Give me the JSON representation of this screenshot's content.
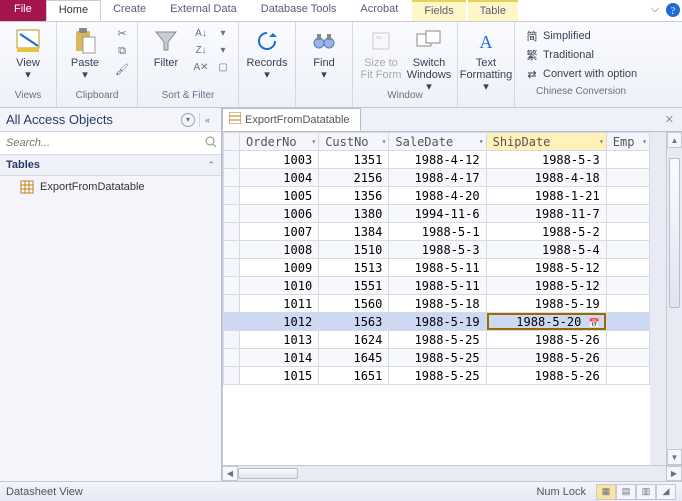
{
  "menubar": {
    "file": "File",
    "tabs": [
      "Home",
      "Create",
      "External Data",
      "Database Tools",
      "Acrobat"
    ],
    "context_tabs": [
      "Fields",
      "Table"
    ],
    "active": "Home"
  },
  "ribbon": {
    "views": {
      "view_label": "View",
      "group": "Views"
    },
    "clipboard": {
      "paste": "Paste",
      "group": "Clipboard"
    },
    "sortfilter": {
      "filter": "Filter",
      "group": "Sort & Filter"
    },
    "records": {
      "records": "Records",
      "group": ""
    },
    "find": {
      "find": "Find",
      "group": ""
    },
    "window": {
      "size": "Size to\nFit Form",
      "switch": "Switch\nWindows",
      "group": "Window"
    },
    "textfmt": {
      "text": "Text\nFormatting",
      "group": ""
    },
    "chinese": {
      "simplified": "Simplified",
      "traditional": "Traditional",
      "convert": "Convert with option",
      "group": "Chinese Conversion"
    }
  },
  "nav": {
    "title": "All Access Objects",
    "search_placeholder": "Search...",
    "group_tables": "Tables",
    "items": [
      "ExportFromDatatable"
    ]
  },
  "doc": {
    "tabname": "ExportFromDatatable",
    "columns": [
      "OrderNo",
      "CustNo",
      "SaleDate",
      "ShipDate",
      "Emp"
    ],
    "sorted_col": "ShipDate",
    "selected_row_index": 9,
    "rows": [
      {
        "OrderNo": "1003",
        "CustNo": "1351",
        "SaleDate": "1988-4-12",
        "ShipDate": "1988-5-3"
      },
      {
        "OrderNo": "1004",
        "CustNo": "2156",
        "SaleDate": "1988-4-17",
        "ShipDate": "1988-4-18"
      },
      {
        "OrderNo": "1005",
        "CustNo": "1356",
        "SaleDate": "1988-4-20",
        "ShipDate": "1988-1-21"
      },
      {
        "OrderNo": "1006",
        "CustNo": "1380",
        "SaleDate": "1994-11-6",
        "ShipDate": "1988-11-7"
      },
      {
        "OrderNo": "1007",
        "CustNo": "1384",
        "SaleDate": "1988-5-1",
        "ShipDate": "1988-5-2"
      },
      {
        "OrderNo": "1008",
        "CustNo": "1510",
        "SaleDate": "1988-5-3",
        "ShipDate": "1988-5-4"
      },
      {
        "OrderNo": "1009",
        "CustNo": "1513",
        "SaleDate": "1988-5-11",
        "ShipDate": "1988-5-12"
      },
      {
        "OrderNo": "1010",
        "CustNo": "1551",
        "SaleDate": "1988-5-11",
        "ShipDate": "1988-5-12"
      },
      {
        "OrderNo": "1011",
        "CustNo": "1560",
        "SaleDate": "1988-5-18",
        "ShipDate": "1988-5-19"
      },
      {
        "OrderNo": "1012",
        "CustNo": "1563",
        "SaleDate": "1988-5-19",
        "ShipDate": "1988-5-20"
      },
      {
        "OrderNo": "1013",
        "CustNo": "1624",
        "SaleDate": "1988-5-25",
        "ShipDate": "1988-5-26"
      },
      {
        "OrderNo": "1014",
        "CustNo": "1645",
        "SaleDate": "1988-5-25",
        "ShipDate": "1988-5-26"
      },
      {
        "OrderNo": "1015",
        "CustNo": "1651",
        "SaleDate": "1988-5-25",
        "ShipDate": "1988-5-26"
      }
    ]
  },
  "status": {
    "mode": "Datasheet View",
    "numlock": "Num Lock"
  }
}
